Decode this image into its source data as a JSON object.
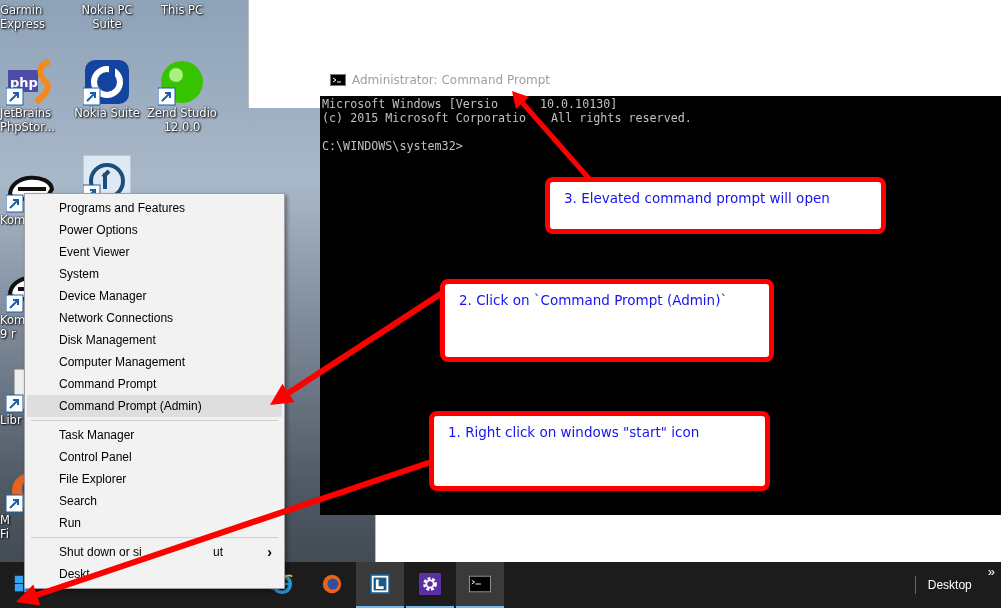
{
  "desktop_icons": [
    {
      "kind": "none",
      "label_lines": [
        "Garmin",
        "Express"
      ]
    },
    {
      "kind": "none",
      "label_lines": [
        "Nokia PC",
        "Suite"
      ]
    },
    {
      "kind": "none",
      "label_lines": [
        "This PC"
      ]
    },
    {
      "kind": "php",
      "label_lines": [
        "JetBrains",
        "PhpStor..."
      ]
    },
    {
      "kind": "nokia",
      "label_lines": [
        "Nokia Suite"
      ]
    },
    {
      "kind": "zend",
      "label_lines": [
        "Zend Studio",
        "12.0.0"
      ]
    },
    {
      "kind": "helmet",
      "label_lines": [
        "Kom"
      ]
    },
    {
      "kind": "clock"
    },
    {
      "kind": "helmet",
      "label_lines": [
        "Kom",
        "9 r"
      ]
    },
    {
      "kind": "document",
      "label_lines": [
        "Libr"
      ]
    },
    {
      "kind": "firefox",
      "label_lines": [
        "M",
        "Fi"
      ]
    }
  ],
  "cmd_window": {
    "title": "Administrator: Command Prompt",
    "output": [
      [
        "Microsoft Windows [Versio",
        "10.0.10130]"
      ],
      [
        "(c) 2015 Microsoft Corporatio",
        "All rights reserved."
      ]
    ],
    "prompt": "C:\\WINDOWS\\system32>"
  },
  "context_menu": {
    "groups": [
      [
        {
          "label": "Programs and Features",
          "selected": false
        },
        {
          "label": "Power Options",
          "selected": false
        },
        {
          "label": "Event Viewer",
          "selected": false
        },
        {
          "label": "System",
          "selected": false
        },
        {
          "label": "Device Manager",
          "selected": false
        },
        {
          "label": "Network Connections",
          "selected": false
        },
        {
          "label": "Disk Management",
          "selected": false
        },
        {
          "label": "Computer Management",
          "selected": false
        },
        {
          "label": "Command Prompt",
          "selected": false
        },
        {
          "label": "Command Prompt (Admin)",
          "selected": true
        }
      ],
      [
        {
          "label": "Task Manager",
          "selected": false
        },
        {
          "label": "Control Panel",
          "selected": false
        },
        {
          "label": "File Explorer",
          "selected": false
        },
        {
          "label": "Search",
          "selected": false
        },
        {
          "label": "Run",
          "selected": false
        }
      ],
      [
        {
          "label": "Shut down or si",
          "label_after_gap": "ut",
          "selected": false,
          "arrow": "›"
        },
        {
          "label": "Deskt",
          "selected": false
        }
      ]
    ]
  },
  "taskbar": {
    "items": [
      {
        "kind": "start",
        "selected": false,
        "running": false
      },
      {
        "kind": "ie",
        "selected": false,
        "running": false
      },
      {
        "kind": "firefox",
        "selected": false,
        "running": false
      },
      {
        "kind": "lapp",
        "selected": true,
        "running": true
      },
      {
        "kind": "gear",
        "selected": false,
        "running": true
      },
      {
        "kind": "cmd",
        "selected": true,
        "running": true
      }
    ],
    "toolbar_label": "Desktop",
    "overflow": "»"
  },
  "callouts": [
    {
      "text": "3. Elevated command prompt will open"
    },
    {
      "text": "2. Click on `Command Prompt (Admin)`"
    },
    {
      "text": "1. Right click on windows \"start\" icon"
    }
  ]
}
